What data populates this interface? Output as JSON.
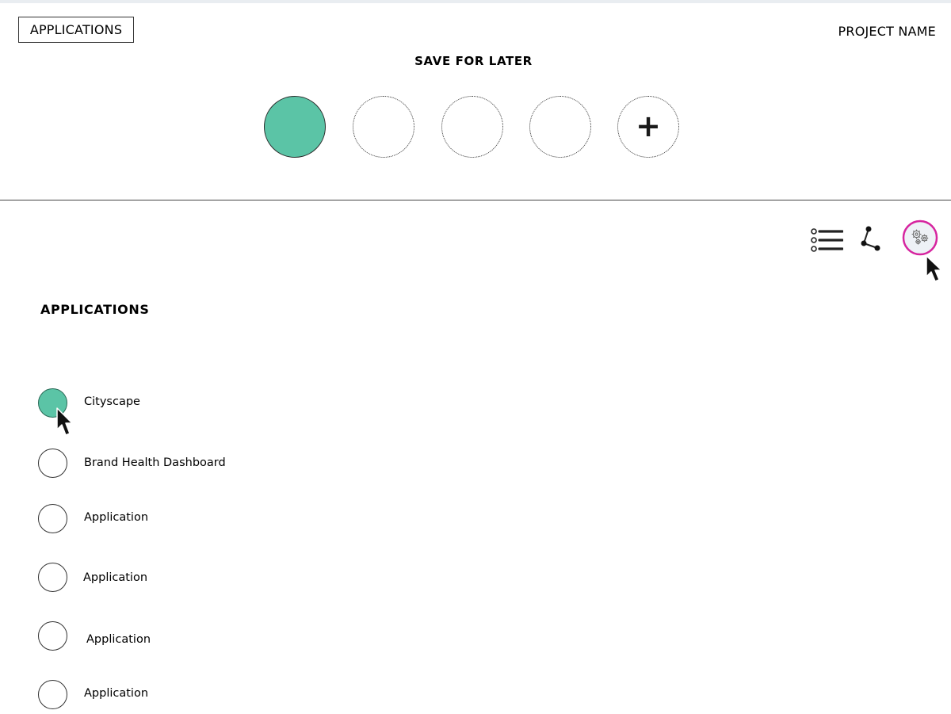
{
  "header": {
    "applications_button": "APPLICATIONS",
    "project_name": "PROJECT NAME",
    "save_for_later_title": "SAVE FOR LATER",
    "slots": [
      {
        "state": "filled"
      },
      {
        "state": "empty"
      },
      {
        "state": "empty"
      },
      {
        "state": "empty"
      },
      {
        "state": "add",
        "symbol": "+"
      }
    ]
  },
  "toolbar": {
    "icons": [
      "list-icon",
      "network-icon",
      "settings-gears-icon"
    ],
    "active": "settings-gears-icon"
  },
  "applications": {
    "title": "APPLICATIONS",
    "items": [
      {
        "label": "Cityscape",
        "selected": true
      },
      {
        "label": "Brand Health Dashboard",
        "selected": false
      },
      {
        "label": "Application",
        "selected": false
      },
      {
        "label": "Application",
        "selected": false
      },
      {
        "label": "Application",
        "selected": false
      },
      {
        "label": "Application",
        "selected": false
      }
    ]
  },
  "colors": {
    "accent_green": "#5bc4a6",
    "settings_ring": "#d6249f"
  }
}
